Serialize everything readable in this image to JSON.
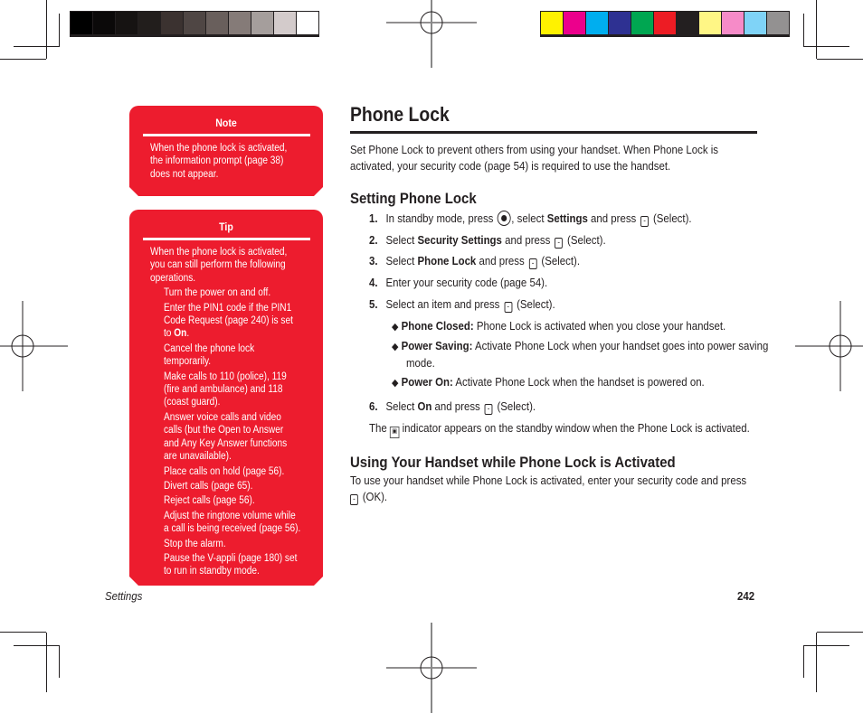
{
  "color_bars": {
    "grayscale": [
      "#000000",
      "#0b0909",
      "#161312",
      "#221e1c",
      "#3b3230",
      "#4f4644",
      "#695f5c",
      "#857b78",
      "#a59e9c",
      "#d3cbcb",
      "#ffffff"
    ],
    "process": [
      "#fff200",
      "#ec008c",
      "#00aeef",
      "#2e3192",
      "#00a651",
      "#ed1c24",
      "#231f20",
      "#fff685",
      "#f68bc8",
      "#7fd3f7",
      "#939191"
    ]
  },
  "sidebar": {
    "note": {
      "title": "Note",
      "body": [
        "When the phone lock is activated,",
        "the information prompt (page 38)",
        "does not appear."
      ]
    },
    "tip": {
      "title": "Tip",
      "intro": [
        "When the phone lock is activated,",
        "you can still perform the following",
        "operations."
      ],
      "items": [
        [
          "Turn the power on and off."
        ],
        [
          "Enter the PIN1 code if the PIN1",
          "Code Request (page 240) is set"
        ],
        [
          "Cancel the phone lock",
          "temporarily."
        ],
        [
          "Make calls to 110 (police), 119",
          "(fire and ambulance) and 118",
          "(coast guard)."
        ],
        [
          "Answer voice calls and video",
          "calls (but the Open to Answer",
          "and Any Key Answer functions",
          "are unavailable)."
        ],
        [
          "Place calls on hold (page 56)."
        ],
        [
          "Divert calls (page 65)."
        ],
        [
          "Reject calls (page 56)."
        ],
        [
          "Adjust the ringtone volume while",
          "a call is being received (page 56)."
        ],
        [
          "Stop the alarm."
        ],
        [
          "Pause the V-appli (page 180) set",
          "to run in standby mode."
        ]
      ],
      "pin_item_tail_prefix": "to ",
      "pin_item_tail_bold": "On",
      "pin_item_tail_suffix": "."
    },
    "accent_color": "#ed1c2e"
  },
  "main": {
    "title": "Phone Lock",
    "intro": [
      "Set Phone Lock to prevent others from using your handset. When Phone Lock is",
      "activated, your security code (page 54) is required to use the handset."
    ],
    "section1": {
      "heading": "Setting Phone Lock",
      "steps": [
        {
          "num": "1.",
          "a": "In standby mode, press ",
          "b": ", select ",
          "bold": "Settings",
          "c": " and press ",
          "d": " (Select)."
        },
        {
          "num": "2.",
          "a": "Select ",
          "bold": "Security Settings",
          "c": " and press ",
          "d": " (Select)."
        },
        {
          "num": "3.",
          "a": "Select ",
          "bold": "Phone Lock",
          "c": " and press ",
          "d": " (Select)."
        },
        {
          "num": "4.",
          "text": "Enter your security code (page 54)."
        },
        {
          "num": "5.",
          "a": "Select an item and press ",
          "d": " (Select)."
        },
        {
          "num": "6.",
          "a": "Select ",
          "bold": "On",
          "c": " and press ",
          "d": " (Select)."
        }
      ],
      "options": [
        {
          "label": "Phone Closed:",
          "text": " Phone Lock is activated when you close your handset."
        },
        {
          "label": "Power Saving:",
          "text": " Activate Phone Lock when your handset goes into power saving"
        },
        {
          "label": "Power On:",
          "text": " Activate Phone Lock when the handset is powered on."
        }
      ],
      "power_saving_cont": "mode.",
      "indicator_prefix": "The ",
      "indicator_suffix": " indicator appears on the standby window when the Phone Lock is activated."
    },
    "section2": {
      "heading": "Using Your Handset while Phone Lock is Activated",
      "text": "To use your handset while Phone Lock is activated, enter your security code and press",
      "text_cont": " (OK)."
    },
    "key_glyph": "-",
    "bullet_glyph": "◆",
    "lock_indicator_glyph": "🔒"
  },
  "footer": {
    "section": "Settings",
    "page": "242"
  }
}
